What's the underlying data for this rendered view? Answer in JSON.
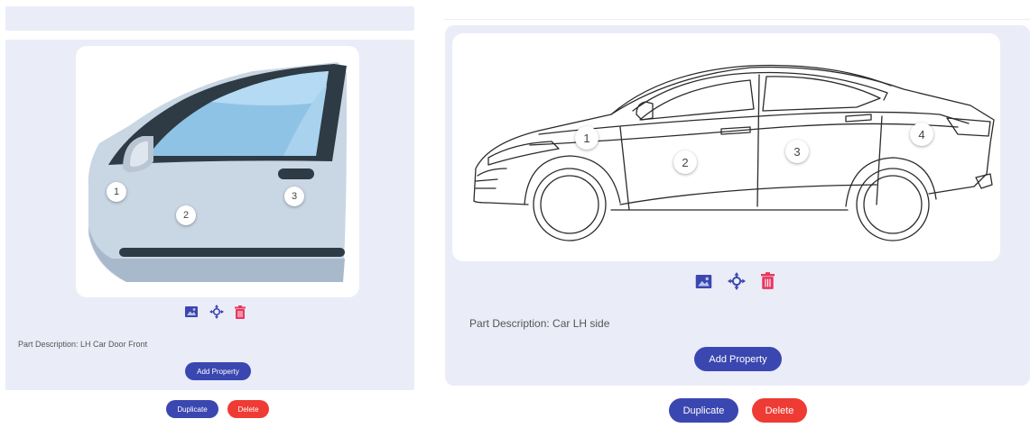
{
  "colors": {
    "panel_bg": "#eaecf8",
    "primary": "#3b47b0",
    "danger": "#ee3b34",
    "trash": "#e8375e"
  },
  "left_card": {
    "markers": [
      "1",
      "2",
      "3"
    ],
    "description_label": "Part Description:",
    "description_value": "LH Car Door Front",
    "add_property_label": "Add Property",
    "icons": [
      "image-icon",
      "move-icon",
      "trash-icon"
    ]
  },
  "right_card": {
    "markers": [
      "1",
      "2",
      "3",
      "4"
    ],
    "description_label": "Part Description:",
    "description_value": "Car LH side",
    "add_property_label": "Add Property",
    "icons": [
      "image-icon",
      "move-icon",
      "trash-icon"
    ]
  },
  "left_actions": {
    "duplicate_label": "Duplicate",
    "delete_label": "Delete"
  },
  "right_actions": {
    "duplicate_label": "Duplicate",
    "delete_label": "Delete"
  }
}
